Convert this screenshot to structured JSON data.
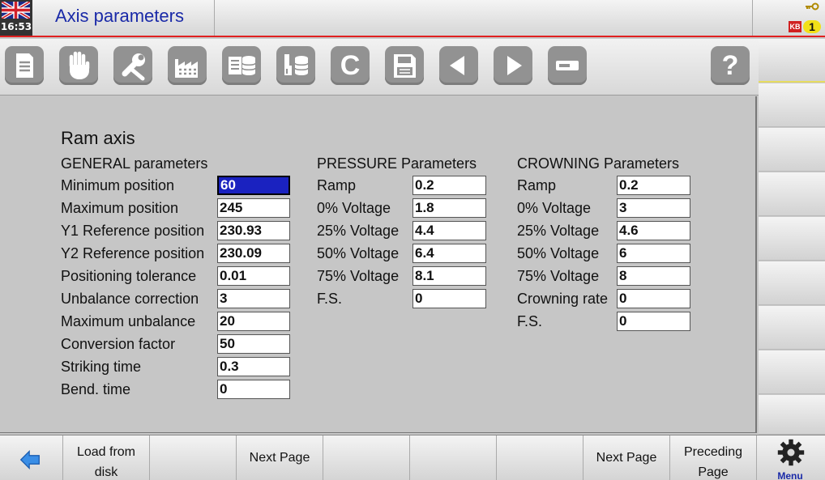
{
  "header": {
    "clock": "16:53",
    "title": "Axis parameters",
    "status": {
      "key_icon": "key-icon",
      "kb_label": "KB",
      "level": "1"
    },
    "colors": {
      "title": "#1a2aa8",
      "divider": "#e02020",
      "level_badge": "#f2e018"
    }
  },
  "toolbar": {
    "buttons": [
      {
        "name": "document-icon"
      },
      {
        "name": "hand-icon"
      },
      {
        "name": "wrench-icon"
      },
      {
        "name": "factory-icon"
      },
      {
        "name": "database-list-icon"
      },
      {
        "name": "tool-database-icon"
      },
      {
        "name": "c-icon",
        "label": "C"
      },
      {
        "name": "save-icon"
      },
      {
        "name": "arrow-left-icon"
      },
      {
        "name": "arrow-right-icon"
      },
      {
        "name": "minus-icon"
      },
      {
        "name": "help-icon",
        "label": "?"
      }
    ]
  },
  "main": {
    "section_title": "Ram axis",
    "general": {
      "header": "GENERAL parameters",
      "rows": [
        {
          "label": "Minimum position",
          "value": "60"
        },
        {
          "label": "Maximum position",
          "value": "245"
        },
        {
          "label": "Y1 Reference position",
          "value": "230.93"
        },
        {
          "label": "Y2 Reference position",
          "value": "230.09"
        },
        {
          "label": "Positioning tolerance",
          "value": "0.01"
        },
        {
          "label": "Unbalance correction",
          "value": "3"
        },
        {
          "label": "Maximum unbalance",
          "value": "20"
        },
        {
          "label": "Conversion factor",
          "value": "50"
        },
        {
          "label": "Striking time",
          "value": "0.3"
        },
        {
          "label": "Bend. time",
          "value": "0"
        }
      ]
    },
    "pressure": {
      "header": "PRESSURE Parameters",
      "rows": [
        {
          "label": "Ramp",
          "value": "0.2"
        },
        {
          "label": "0% Voltage",
          "value": "1.8"
        },
        {
          "label": "25% Voltage",
          "value": "4.4"
        },
        {
          "label": "50% Voltage",
          "value": "6.4"
        },
        {
          "label": "75% Voltage",
          "value": "8.1"
        },
        {
          "label": "F.S.",
          "value": "0"
        }
      ]
    },
    "crowning": {
      "header": "CROWNING Parameters",
      "rows": [
        {
          "label": "Ramp",
          "value": "0.2"
        },
        {
          "label": "0% Voltage",
          "value": "3"
        },
        {
          "label": "25% Voltage",
          "value": "4.6"
        },
        {
          "label": "50% Voltage",
          "value": "6"
        },
        {
          "label": "75% Voltage",
          "value": "8"
        },
        {
          "label": "Crowning rate",
          "value": "0"
        },
        {
          "label": "F.S.",
          "value": "0"
        }
      ]
    },
    "colors": {
      "selected_field": "#1a22c0"
    }
  },
  "bottombar": {
    "back_icon": "back-arrow-icon",
    "buttons": [
      {
        "label1": "Load from",
        "label2": "disk"
      },
      {
        "label1": "",
        "label2": ""
      },
      {
        "label": "Next Page"
      },
      {
        "label": ""
      },
      {
        "label": ""
      },
      {
        "label": ""
      },
      {
        "label": "Next Page"
      },
      {
        "label1": "Preceding",
        "label2": "Page"
      }
    ],
    "menu_label": "Menu"
  }
}
